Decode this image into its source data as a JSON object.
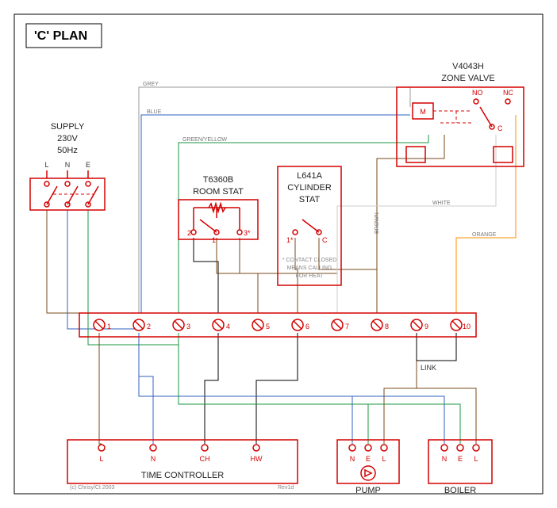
{
  "title": "'C' PLAN",
  "supply": {
    "label": "SUPPLY",
    "voltage": "230V",
    "freq": "50Hz",
    "L": "L",
    "N": "N",
    "E": "E"
  },
  "room_stat": {
    "type": "T6360B",
    "label": "ROOM STAT",
    "t1": "1",
    "t2": "2",
    "t3": "3*"
  },
  "cyl_stat": {
    "type": "L641A",
    "label": "CYLINDER",
    "label2": "STAT",
    "t1": "1*",
    "tC": "C",
    "note1": "* CONTACT CLOSED",
    "note2": "MEANS CALLING",
    "note3": "FOR HEAT"
  },
  "valve": {
    "type": "V4043H",
    "label": "ZONE VALVE",
    "M": "M",
    "NO": "NO",
    "NC": "NC",
    "C": "C"
  },
  "strip": {
    "link_label": "LINK",
    "t": [
      "1",
      "2",
      "3",
      "4",
      "5",
      "6",
      "7",
      "8",
      "9",
      "10"
    ]
  },
  "tc": {
    "label": "TIME CONTROLLER",
    "L": "L",
    "N": "N",
    "CH": "CH",
    "HW": "HW",
    "copyright": "(c) Chrisy/Ct 2003",
    "rev": "Rev1d"
  },
  "pump": {
    "label": "PUMP",
    "N": "N",
    "E": "E",
    "L": "L"
  },
  "boiler": {
    "label": "BOILER",
    "N": "N",
    "E": "E",
    "L": "L"
  },
  "wires": {
    "grey": "GREY",
    "blue": "BLUE",
    "gy": "GREEN/YELLOW",
    "brown": "BROWN",
    "white": "WHITE",
    "orange": "ORANGE"
  }
}
